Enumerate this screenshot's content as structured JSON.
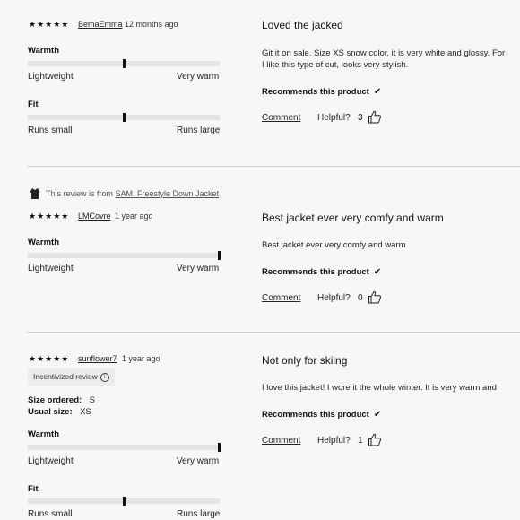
{
  "icons": {
    "star": "★",
    "check": "✔",
    "thumb": "thumbs-up-icon",
    "info": "info-icon",
    "jacket": "jacket-icon"
  },
  "reviews": [
    {
      "stars": "★★★★★",
      "user": "BemaEmma",
      "date": "12 months ago",
      "sliders": [
        {
          "label": "Warmth",
          "left": "Lightweight",
          "right": "Very warm",
          "value_fraction": 0.5
        },
        {
          "label": "Fit",
          "left": "Runs small",
          "right": "Runs large",
          "value_fraction": 0.5
        }
      ],
      "title": "Loved the jacked",
      "body_lines": [
        "Git it on sale. Size XS snow color, it is very white and glossy. For",
        "I like this type of cut, looks very stylish."
      ],
      "recommends": "Recommends this product",
      "comment": "Comment",
      "helpful_label": "Helpful?",
      "helpful_count": "3"
    },
    {
      "from_prefix": "This review is from",
      "from_product": "SAM. Freestyle Down Jacket",
      "stars": "★★★★★",
      "user": "LMCovre",
      "date": "1 year ago",
      "sliders": [
        {
          "label": "Warmth",
          "left": "Lightweight",
          "right": "Very warm",
          "value_fraction": 1.0
        }
      ],
      "title": "Best jacket ever very comfy and warm",
      "body_lines": [
        "Best jacket ever very comfy and warm"
      ],
      "recommends": "Recommends this product",
      "comment": "Comment",
      "helpful_label": "Helpful?",
      "helpful_count": "0"
    },
    {
      "stars": "★★★★★",
      "user": "sunflower7",
      "date": "1 year ago",
      "badge": "Incentivized review",
      "size_ordered_label": "Size ordered:",
      "size_ordered": "S",
      "usual_size_label": "Usual size:",
      "usual_size": "XS",
      "sliders": [
        {
          "label": "Warmth",
          "left": "Lightweight",
          "right": "Very warm",
          "value_fraction": 1.0
        },
        {
          "label": "Fit",
          "left": "Runs small",
          "right": "Runs large",
          "value_fraction": 0.5
        }
      ],
      "title": "Not only for skiing",
      "body_lines": [
        "I love this jacket! I wore it the whole winter. It is very warm and"
      ],
      "recommends": "Recommends this product",
      "comment": "Comment",
      "helpful_label": "Helpful?",
      "helpful_count": "1"
    }
  ]
}
